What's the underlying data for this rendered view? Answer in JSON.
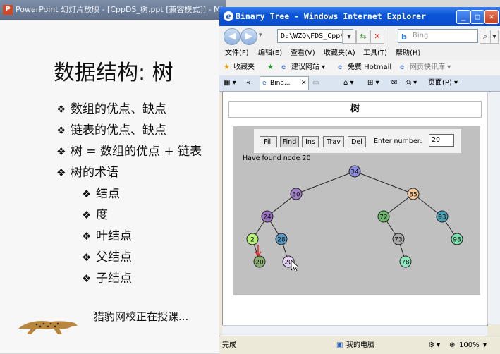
{
  "ppt": {
    "window_title": "PowerPoint 幻灯片放映 - [CppDS_树.ppt [兼容模式]] - Microso",
    "app_icon": "P",
    "slide_title": "数据结构: 树",
    "bullets": [
      "数组的优点、缺点",
      "链表的优点、缺点",
      "树 = 数组的优点 + 链表",
      "树的术语"
    ],
    "sub_bullets": [
      "结点",
      "度",
      "叶结点",
      "父结点",
      "子结点"
    ],
    "bullet_glyph": "❖",
    "footer_text": "猎豹网校正在授课..."
  },
  "ie": {
    "window_title": "Binary Tree - Windows Internet Explorer",
    "address": "D:\\WZQ\\FDS_Cpp\\树\\",
    "search_placeholder": "Bing",
    "menu": [
      "文件(F)",
      "编辑(E)",
      "查看(V)",
      "收藏夹(A)",
      "工具(T)",
      "帮助(H)"
    ],
    "favorites": {
      "label": "收藏夹",
      "suggested": "建议网站 ▾",
      "hotmail": "免费 Hotmail",
      "webslice": "网页快讯库 ▾"
    },
    "tab_label": "Bina...",
    "page_menu": "页面(P) ▾",
    "status_left": "完成",
    "status_zone": "我的电脑",
    "zoom": "100%"
  },
  "applet": {
    "title": "树",
    "buttons": [
      "Fill",
      "Find",
      "Ins",
      "Trav",
      "Del"
    ],
    "active_button": "Find",
    "enter_label": "Enter number:",
    "input_value": "20",
    "message": "Have found node 20",
    "nodes": [
      {
        "label": "34",
        "color": "#8a8ad8"
      },
      {
        "label": "30",
        "color": "#a07fc8"
      },
      {
        "label": "85",
        "color": "#f5c99a"
      },
      {
        "label": "24",
        "color": "#9a74c2"
      },
      {
        "label": "72",
        "color": "#6fb76f"
      },
      {
        "label": "93",
        "color": "#4a9fb0"
      },
      {
        "label": "2",
        "color": "#b7f07a"
      },
      {
        "label": "28",
        "color": "#5c9bc4"
      },
      {
        "label": "73",
        "color": "#a8a8a8"
      },
      {
        "label": "98",
        "color": "#7fe0b0"
      },
      {
        "label": "20",
        "color": "#8aac74"
      },
      {
        "label": "20",
        "color": "#e4d4f4"
      },
      {
        "label": "78",
        "color": "#8ee8c0"
      }
    ],
    "edges": [
      [
        0,
        1
      ],
      [
        0,
        2
      ],
      [
        1,
        3
      ],
      [
        2,
        4
      ],
      [
        2,
        5
      ],
      [
        3,
        6
      ],
      [
        3,
        7
      ],
      [
        4,
        8
      ],
      [
        5,
        9
      ],
      [
        6,
        10
      ],
      [
        7,
        11
      ],
      [
        8,
        12
      ]
    ],
    "arrow_color": "#e02020"
  }
}
